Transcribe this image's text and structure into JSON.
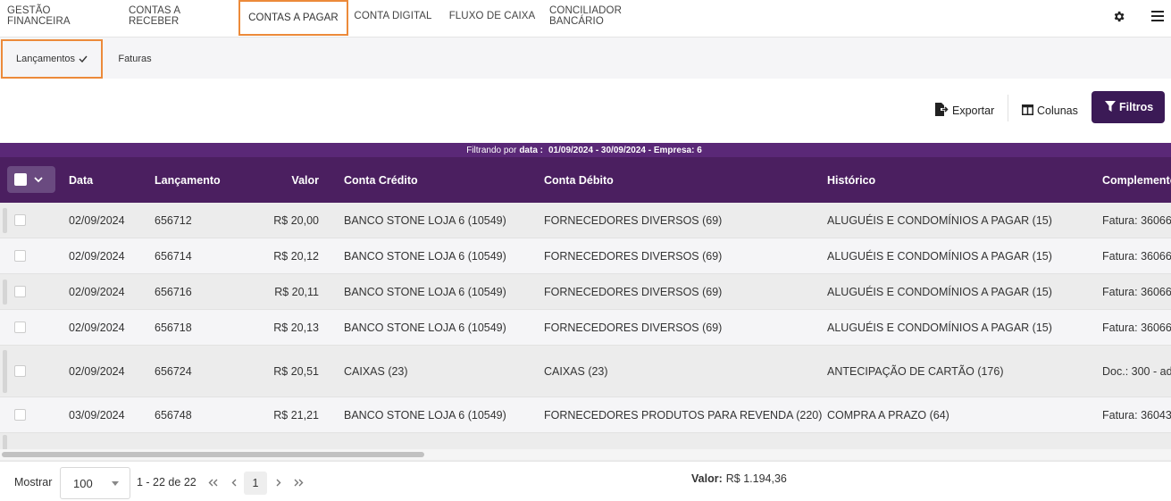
{
  "nav": {
    "tabs": [
      {
        "label": "GESTÃO FINANCEIRA"
      },
      {
        "label": "CONTAS A RECEBER"
      },
      {
        "label": "CONTAS A PAGAR"
      },
      {
        "label": "CONTA DIGITAL"
      },
      {
        "label": "FLUXO DE CAIXA"
      },
      {
        "label": "CONCILIADOR BANCÁRIO"
      }
    ],
    "active_tab": "CONTAS A PAGAR"
  },
  "subnav": {
    "tabs": [
      {
        "label": "Lançamentos"
      },
      {
        "label": "Faturas"
      }
    ],
    "active_tab": "Lançamentos"
  },
  "toolbar": {
    "export_label": "Exportar",
    "columns_label": "Colunas",
    "filters_label": "Filtros"
  },
  "filter": {
    "prefix": "Filtrando por",
    "data_label": "data :",
    "text": "01/09/2024 - 30/09/2024 - Empresa: 6"
  },
  "table": {
    "headers": {
      "data": "Data",
      "lancamento": "Lançamento",
      "valor": "Valor",
      "conta_credito": "Conta Crédito",
      "conta_debito": "Conta Débito",
      "historico": "Histórico",
      "complemento": "Complemento"
    },
    "rows": [
      {
        "data": "02/09/2024",
        "lancamento": "656712",
        "valor": "R$ 20,00",
        "conta_credito": "BANCO STONE LOJA 6 (10549)",
        "conta_debito": "FORNECEDORES DIVERSOS (69)",
        "historico": "ALUGUÉIS E CONDOMÍNIOS A PAGAR (15)",
        "complemento": "Fatura: 36066"
      },
      {
        "data": "02/09/2024",
        "lancamento": "656714",
        "valor": "R$ 20,12",
        "conta_credito": "BANCO STONE LOJA 6 (10549)",
        "conta_debito": "FORNECEDORES DIVERSOS (69)",
        "historico": "ALUGUÉIS E CONDOMÍNIOS A PAGAR (15)",
        "complemento": "Fatura: 36066"
      },
      {
        "data": "02/09/2024",
        "lancamento": "656716",
        "valor": "R$ 20,11",
        "conta_credito": "BANCO STONE LOJA 6 (10549)",
        "conta_debito": "FORNECEDORES DIVERSOS (69)",
        "historico": "ALUGUÉIS E CONDOMÍNIOS A PAGAR (15)",
        "complemento": "Fatura: 36066"
      },
      {
        "data": "02/09/2024",
        "lancamento": "656718",
        "valor": "R$ 20,13",
        "conta_credito": "BANCO STONE LOJA 6 (10549)",
        "conta_debito": "FORNECEDORES DIVERSOS (69)",
        "historico": "ALUGUÉIS E CONDOMÍNIOS A PAGAR (15)",
        "complemento": "Fatura: 36066"
      },
      {
        "data": "02/09/2024",
        "lancamento": "656724",
        "valor": "R$ 20,51",
        "conta_credito": "CAIXAS (23)",
        "conta_debito": "CAIXAS (23)",
        "historico": "ANTECIPAÇÃO DE CARTÃO (176)",
        "complemento": "Doc.: 300 - ad"
      },
      {
        "data": "03/09/2024",
        "lancamento": "656748",
        "valor": "R$ 21,21",
        "conta_credito": "BANCO STONE LOJA 6 (10549)",
        "conta_debito": "FORNECEDORES PRODUTOS PARA REVENDA (220)",
        "historico": "COMPRA A PRAZO (64)",
        "complemento": "Fatura: 36043"
      }
    ]
  },
  "footer": {
    "show_label": "Mostrar",
    "page_size": "100",
    "range": "1 - 22 de 22",
    "current_page": "1",
    "total_label": "Valor:",
    "total_value": "R$ 1.194,36"
  },
  "colors": {
    "accent_orange": "#ec8a3a",
    "header_purple": "#4b1f60",
    "filter_purple": "#5a2877",
    "button_purple": "#3b1a56"
  }
}
